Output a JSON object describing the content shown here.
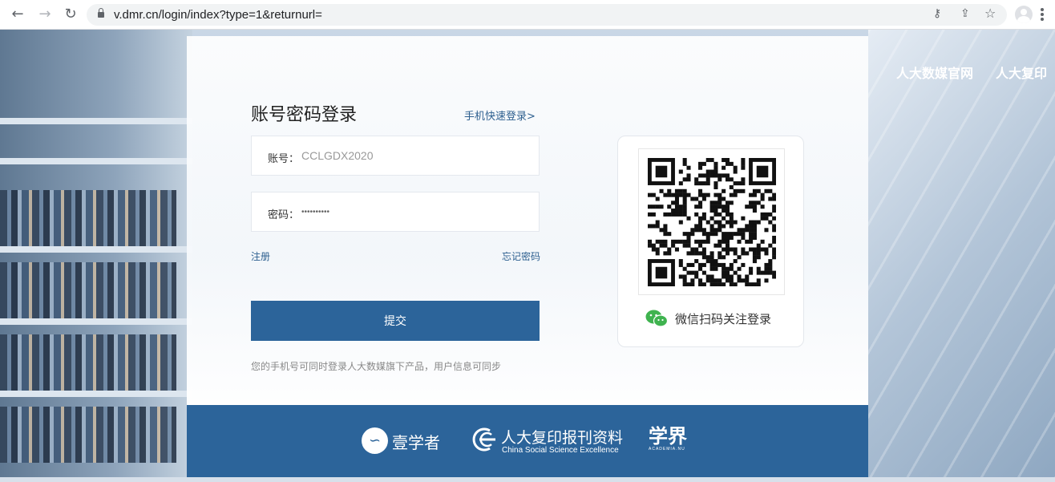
{
  "browser": {
    "url": "v.dmr.cn/login/index?type=1&returnurl="
  },
  "top_nav": {
    "links": [
      "人大数媒官网",
      "人大复印"
    ]
  },
  "login": {
    "title": "账号密码登录",
    "phone_login_link": "手机快速登录>",
    "account_label": "账号：",
    "account_value": "CCLGDX2020",
    "password_label": "密码：",
    "password_value": "••••••••••",
    "register_link": "注册",
    "forgot_link": "忘记密码",
    "submit_label": "提交",
    "hint": "您的手机号可同时登录人大数媒旗下产品，用户信息可同步"
  },
  "qr": {
    "label": "微信扫码关注登录"
  },
  "footer": {
    "logo_1": "壹学者",
    "logo_2_cn": "人大复印报刊资料",
    "logo_2_en": "China Social Science Excellence",
    "logo_3_cn": "学界",
    "logo_3_en": "ACADEMIA.NU"
  },
  "colors": {
    "primary": "#2c649a",
    "link": "#2d5f8f",
    "wechat": "#3fb34f"
  }
}
